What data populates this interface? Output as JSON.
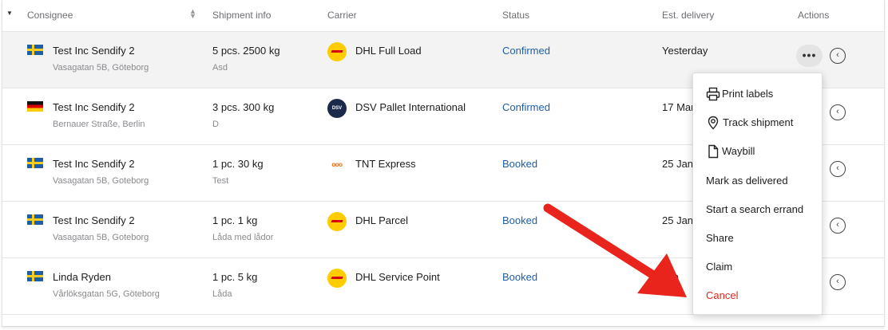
{
  "table": {
    "headers": {
      "consignee": "Consignee",
      "shipment_info": "Shipment info",
      "carrier": "Carrier",
      "status": "Status",
      "est_delivery": "Est. delivery",
      "actions": "Actions"
    },
    "rows": [
      {
        "flag": "sweden-flag-icon",
        "name": "Test Inc Sendify 2",
        "address": "Vasagatan 5B, Göteborg",
        "shipment": "5 pcs. 2500 kg",
        "note": "Asd",
        "carrier": "DHL Full Load",
        "carrier_logo": "dhl-logo-icon",
        "status": "Confirmed",
        "delivery": "Yesterday"
      },
      {
        "flag": "germany-flag-icon",
        "name": "Test Inc Sendify 2",
        "address": "Bernauer Straße, Berlin",
        "shipment": "3 pcs. 300 kg",
        "note": "D",
        "carrier": "DSV Pallet International",
        "carrier_logo": "dsv-logo-icon",
        "status": "Confirmed",
        "delivery": "17 Mar"
      },
      {
        "flag": "sweden-flag-icon",
        "name": "Test Inc Sendify 2",
        "address": "Vasagatan 5B, Goteborg",
        "shipment": "1 pc. 30 kg",
        "note": "Test",
        "carrier": "TNT Express",
        "carrier_logo": "tnt-logo-icon",
        "status": "Booked",
        "delivery": "25 Jan"
      },
      {
        "flag": "sweden-flag-icon",
        "name": "Test Inc Sendify 2",
        "address": "Vasagatan 5B, Goteborg",
        "shipment": "1 pc. 1 kg",
        "note": "Låda med lådor",
        "carrier": "DHL Parcel",
        "carrier_logo": "dhl-logo-icon",
        "status": "Booked",
        "delivery": "25 Jan"
      },
      {
        "flag": "sweden-flag-icon",
        "name": "Linda Ryden",
        "address": "Vårlöksgatan 5G, Göteborg",
        "shipment": "1 pc. 5 kg",
        "note": "Låda",
        "carrier": "DHL Service Point",
        "carrier_logo": "dhl-logo-icon",
        "status": "Booked",
        "delivery": "Jan"
      }
    ]
  },
  "actions_menu": {
    "items": [
      {
        "label": "Print labels",
        "icon": "printer-icon"
      },
      {
        "label": "Track shipment",
        "icon": "location-pin-icon"
      },
      {
        "label": "Waybill",
        "icon": "document-icon"
      },
      {
        "label": "Mark as delivered"
      },
      {
        "label": "Start a search errand"
      },
      {
        "label": "Share"
      },
      {
        "label": "Claim"
      },
      {
        "label": "Cancel"
      }
    ],
    "more_glyph": "•••",
    "chevron_glyph": "‹"
  },
  "colors": {
    "status_link": "#1f5fa6",
    "cancel": "#e0281e",
    "annotation_arrow": "#e8241c",
    "row_highlight": "#f3f3f3"
  }
}
